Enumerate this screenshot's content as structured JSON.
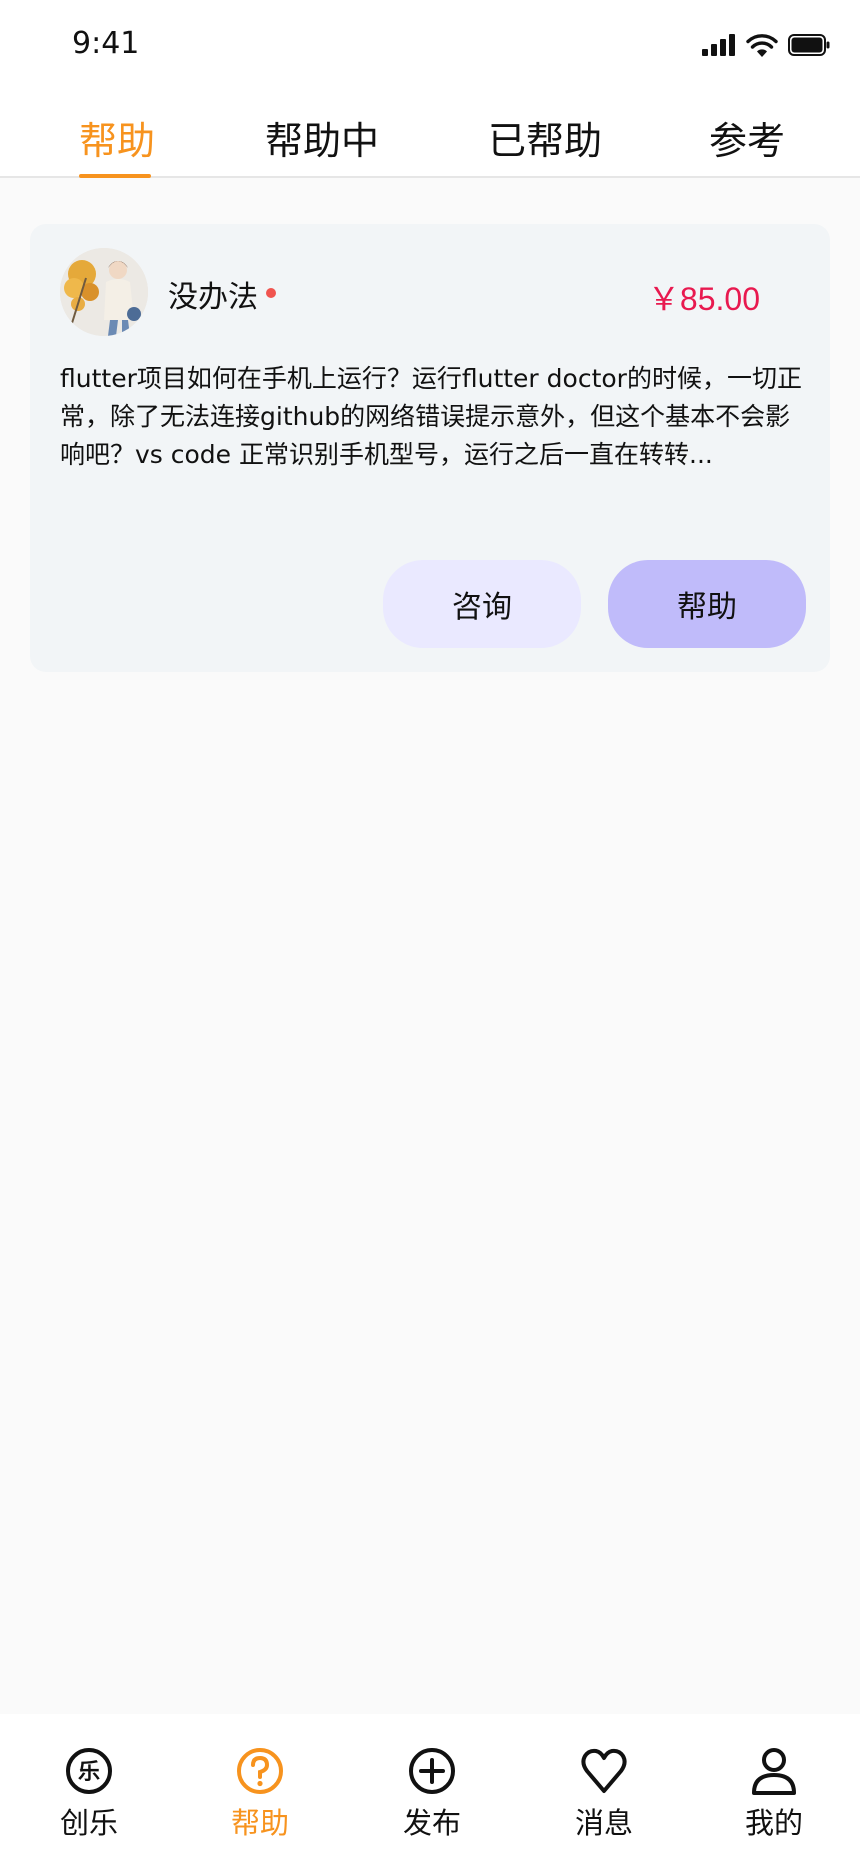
{
  "status_bar": {
    "time": "9:41"
  },
  "tabs": [
    {
      "label": "帮助",
      "active": true
    },
    {
      "label": "帮助中",
      "active": false
    },
    {
      "label": "已帮助",
      "active": false
    },
    {
      "label": "参考",
      "active": false
    }
  ],
  "card": {
    "user_name": "没办法",
    "price": "￥85.00",
    "description": "flutter项目如何在手机上运行？运行flutter doctor的时候，一切正常，除了无法连接github的网络错误提示意外，但这个基本不会影响吧？vs code 正常识别手机型号，运行之后一直在转转...",
    "consult_label": "咨询",
    "help_label": "帮助"
  },
  "bottom_nav": [
    {
      "label": "创乐",
      "icon": "le-circle-icon",
      "glyph": "乐",
      "active": false
    },
    {
      "label": "帮助",
      "icon": "question-circle-icon",
      "active": true
    },
    {
      "label": "发布",
      "icon": "plus-circle-icon",
      "active": false
    },
    {
      "label": "消息",
      "icon": "heart-icon",
      "active": false
    },
    {
      "label": "我的",
      "icon": "person-icon",
      "active": false
    }
  ],
  "colors": {
    "accent": "#f7931e",
    "price": "#e8194f",
    "help_button": "#c0bbfa",
    "consult_button": "#eae9ff"
  }
}
